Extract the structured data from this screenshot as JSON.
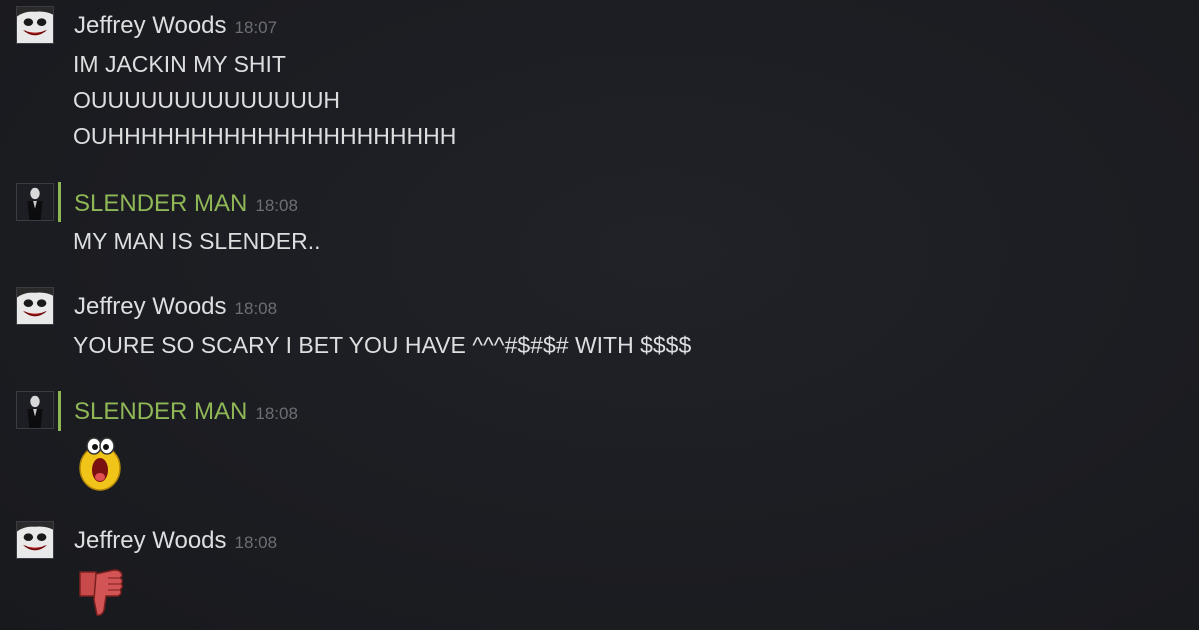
{
  "groups": [
    {
      "author": "Jeffrey Woods",
      "time": "18:07",
      "avatar": "jeff-avatar",
      "lines": [
        "IM JACKIN MY SHIT",
        "OUUUUUUUUUUUUUUH",
        "OUHHHHHHHHHHHHHHHHHHHHH"
      ]
    },
    {
      "author": "SLENDER MAN",
      "time": "18:08",
      "avatar": "slender-avatar",
      "lines": [
        "MY MAN IS SLENDER.."
      ]
    },
    {
      "author": "Jeffrey Woods",
      "time": "18:08",
      "avatar": "jeff-avatar",
      "lines": [
        "YOURE SO SCARY I BET YOU HAVE ^^^#$#$# WITH $$$$"
      ]
    },
    {
      "author": "SLENDER MAN",
      "time": "18:08",
      "avatar": "slender-avatar",
      "emoticon": "shocked-face-emoticon"
    },
    {
      "author": "Jeffrey Woods",
      "time": "18:08",
      "avatar": "jeff-avatar",
      "emoticon": "thumbs-down-emoticon"
    }
  ],
  "colors": {
    "ingame_green": "#8fb756",
    "text": "#dcdedf",
    "timestamp": "#6b6e75",
    "background": "#1b1c20"
  }
}
